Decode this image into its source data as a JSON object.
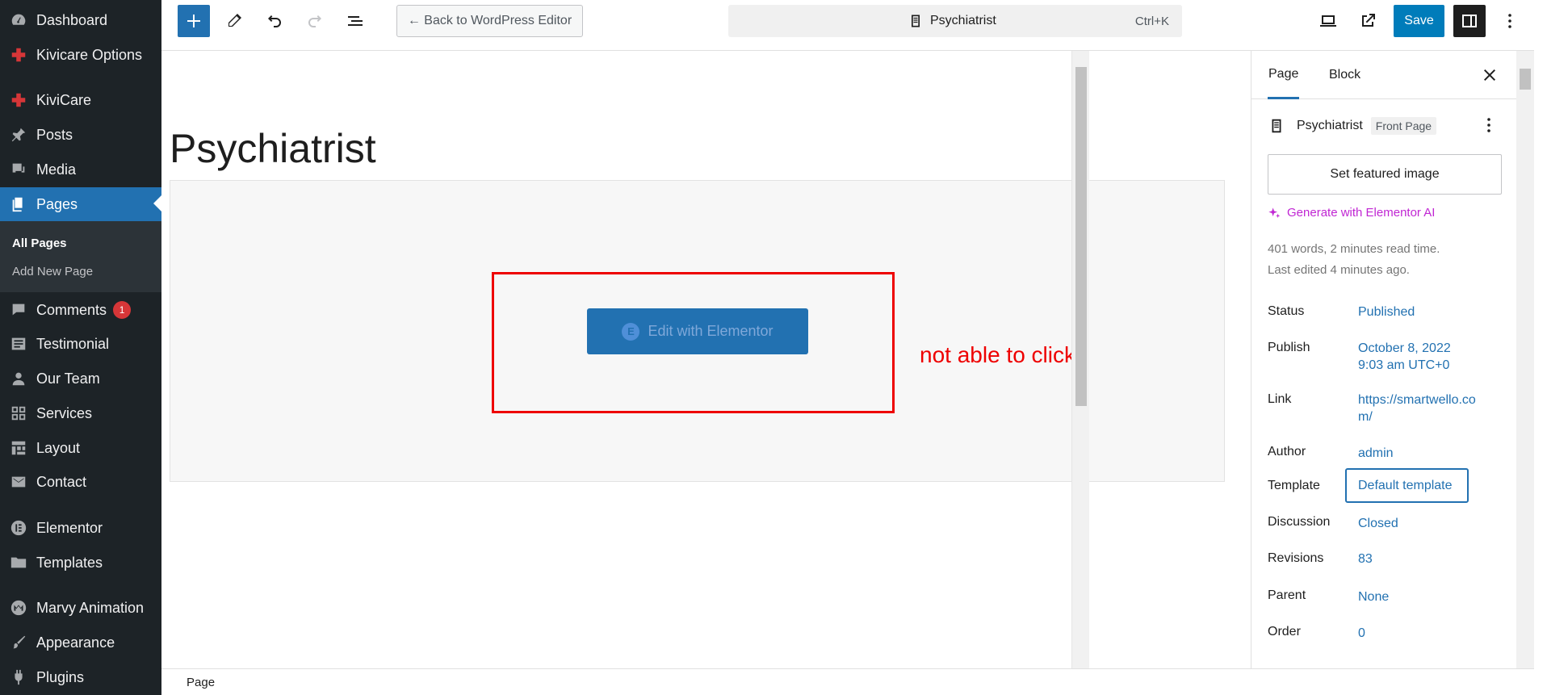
{
  "admin_menu": {
    "items": [
      {
        "label": "Dashboard"
      },
      {
        "label": "Kivicare Options"
      },
      {
        "label": "KiviCare"
      },
      {
        "label": "Posts"
      },
      {
        "label": "Media"
      },
      {
        "label": "Pages"
      },
      {
        "label": "Comments",
        "badge": "1"
      },
      {
        "label": "Testimonial"
      },
      {
        "label": "Our Team"
      },
      {
        "label": "Services"
      },
      {
        "label": "Layout"
      },
      {
        "label": "Contact"
      },
      {
        "label": "Elementor"
      },
      {
        "label": "Templates"
      },
      {
        "label": "Marvy Animation"
      },
      {
        "label": "Appearance"
      },
      {
        "label": "Plugins"
      }
    ],
    "submenu": [
      {
        "label": "All Pages"
      },
      {
        "label": "Add New Page"
      }
    ]
  },
  "header": {
    "back_label": "← Back to WordPress Editor",
    "document_title": "Psychiatrist",
    "shortcut": "Ctrl+K",
    "save_label": "Save"
  },
  "canvas": {
    "page_title": "Psychiatrist",
    "edit_button_label": "Edit with Elementor",
    "annotation": "not able to click"
  },
  "sidebar": {
    "tabs": [
      {
        "label": "Page"
      },
      {
        "label": "Block"
      }
    ],
    "page_name": "Psychiatrist",
    "page_tag": "Front Page",
    "featured_image_label": "Set featured image",
    "generate_ai_label": "Generate with Elementor AI",
    "words_info": "401 words, 2 minutes read time.",
    "last_edited": "Last edited 4 minutes ago.",
    "props": {
      "status": {
        "label": "Status",
        "value": "Published"
      },
      "publish": {
        "label": "Publish",
        "value_line1": "October 8, 2022",
        "value_line2": "9:03 am UTC+0"
      },
      "link": {
        "label": "Link",
        "value_line1": "https://smartwello.co",
        "value_line2": "m/"
      },
      "author": {
        "label": "Author",
        "value": "admin"
      },
      "template": {
        "label": "Template",
        "value": "Default template"
      },
      "discussion": {
        "label": "Discussion",
        "value": "Closed"
      },
      "revisions": {
        "label": "Revisions",
        "value": "83"
      },
      "parent": {
        "label": "Parent",
        "value": "None"
      },
      "order": {
        "label": "Order",
        "value": "0"
      }
    }
  },
  "footer": {
    "breadcrumb": "Page"
  },
  "colors": {
    "admin_bg": "#1d2327",
    "accent": "#2271b1",
    "annotation": "#e00000",
    "ai_purple": "#c026d3"
  }
}
